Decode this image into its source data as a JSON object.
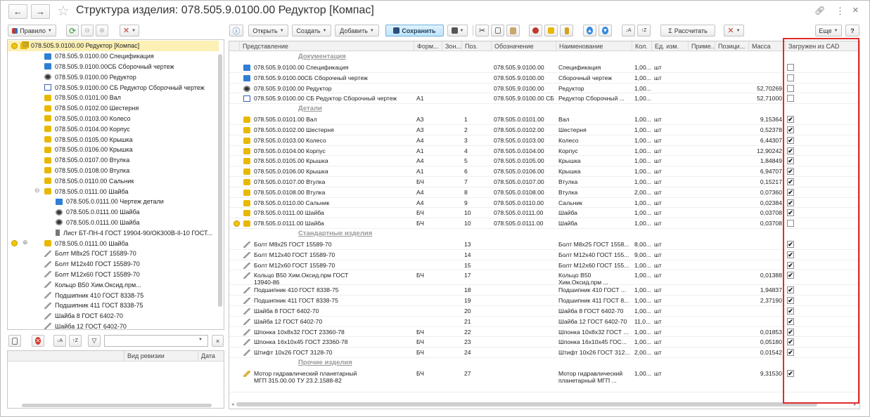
{
  "title": "Структура изделия: 078.505.9.0100.00 Редуктор [Компас]",
  "titlebar": {
    "back": "←",
    "forward": "→",
    "star": "☆",
    "link": "🔗",
    "more": "⋮",
    "close": "×"
  },
  "left_toolbar": {
    "rule_label": "Правило"
  },
  "main_toolbar": {
    "open": "Открыть",
    "create": "Создать",
    "add": "Добавить",
    "save": "Сохранить",
    "calculate": "Рассчитать",
    "more": "Еще",
    "help": "?"
  },
  "tree": [
    {
      "label": "078.505.9.0100.00 Редуктор [Компас]",
      "icon": "assembly-icon",
      "level": 0,
      "selected": true
    },
    {
      "label": "078.505.9.0100.00 Спецификация",
      "icon": "spec-icon",
      "level": 1
    },
    {
      "label": "078.505.9.0100.00СБ Сборочный чертеж",
      "icon": "spec-icon",
      "level": 1
    },
    {
      "label": "078.505.9.0100.00 Редуктор",
      "icon": "model-icon",
      "level": 1
    },
    {
      "label": "078.505.9.0100.00 СБ Редуктор Сборочный чертеж",
      "icon": "drawing-icon",
      "level": 1
    },
    {
      "label": "078.505.0.0101.00 Вал",
      "icon": "part-icon",
      "level": 1
    },
    {
      "label": "078.505.0.0102.00 Шестерня",
      "icon": "part-icon",
      "level": 1
    },
    {
      "label": "078.505.0.0103.00 Колесо",
      "icon": "part-icon",
      "level": 1
    },
    {
      "label": "078.505.0.0104.00 Корпус",
      "icon": "part-icon",
      "level": 1
    },
    {
      "label": "078.505.0.0105.00 Крышка",
      "icon": "part-icon",
      "level": 1
    },
    {
      "label": "078.505.0.0106.00 Крышка",
      "icon": "part-icon",
      "level": 1
    },
    {
      "label": "078.505.0.0107.00 Втулка",
      "icon": "part-icon",
      "level": 1
    },
    {
      "label": "078.505.0.0108.00 Втулка",
      "icon": "part-icon",
      "level": 1
    },
    {
      "label": "078.505.0.0110.00 Сальник",
      "icon": "part-icon",
      "level": 1
    },
    {
      "label": "078.505.0.0111.00 Шайба",
      "icon": "part-icon",
      "level": 1,
      "expanded": true
    },
    {
      "label": "078.505.0.0111.00 Чертеж детали",
      "icon": "spec-icon",
      "level": 2
    },
    {
      "label": "078.505.0.0111.00 Шайба",
      "icon": "model-icon",
      "level": 2
    },
    {
      "label": "078.505.0.0111.00 Шайба",
      "icon": "model-icon",
      "level": 2
    },
    {
      "label": "Лист БТ-ПН-4 ГОСТ 19904-90/ОК300В-II-10 ГОСТ...",
      "icon": "material-icon",
      "level": 2
    },
    {
      "label": "078.505.0.0111.00 Шайба",
      "icon": "part-icon",
      "level": 0,
      "collapsed": true
    },
    {
      "label": "Болт М8х25 ГОСТ 15589-70",
      "icon": "standard-icon",
      "level": 1
    },
    {
      "label": "Болт М12х40 ГОСТ 15589-70",
      "icon": "standard-icon",
      "level": 1
    },
    {
      "label": "Болт М12х60 ГОСТ 15589-70",
      "icon": "standard-icon",
      "level": 1
    },
    {
      "label": "Кольцо B50 Хим.Оксид.прм...",
      "icon": "standard-icon",
      "level": 1
    },
    {
      "label": "Подшипник 410 ГОСТ 8338-75",
      "icon": "standard-icon",
      "level": 1
    },
    {
      "label": "Подшипник 411 ГОСТ 8338-75",
      "icon": "standard-icon",
      "level": 1
    },
    {
      "label": "Шайба 8 ГОСТ 6402-70",
      "icon": "standard-icon",
      "level": 1
    },
    {
      "label": "Шайба 12 ГОСТ 6402-70",
      "icon": "standard-icon",
      "level": 1
    }
  ],
  "revisions": {
    "col_revision": "Вид ревизии",
    "col_date": "Дата"
  },
  "table": {
    "columns": [
      "Представление",
      "Форм...",
      "Зон...",
      "Поз.",
      "Обозначение",
      "Наименование",
      "Кол.",
      "Ед. изм.",
      "Приме...",
      "Позици...",
      "Масса",
      "Загружен из CAD"
    ],
    "rows": [
      {
        "group": "Документация"
      },
      {
        "rep": "078.505.9.0100.00 Спецификация",
        "icon": "spec-icon",
        "fmt": "",
        "pos": "",
        "des": "078.505.9.0100.00",
        "name": "Спецификация",
        "qty": "1,00...",
        "unit": "шт",
        "mass": "",
        "cad": false
      },
      {
        "rep": "078.505.9.0100.00СБ Сборочный чертеж",
        "icon": "spec-icon",
        "fmt": "",
        "pos": "",
        "des": "078.505.9.0100.00",
        "name": "Сборочный чертеж",
        "qty": "1,00...",
        "unit": "шт",
        "mass": "",
        "cad": false
      },
      {
        "rep": "078.505.9.0100.00 Редуктор",
        "icon": "model-icon",
        "fmt": "",
        "pos": "",
        "des": "078.505.9.0100.00",
        "name": "Редуктор",
        "qty": "1,00...",
        "unit": "",
        "mass": "52,70269",
        "cad": false
      },
      {
        "rep": "078.505.9.0100.00 СБ Редуктор Сборочный чертеж",
        "icon": "drawing-icon",
        "fmt": "А1",
        "pos": "",
        "des": "078.505.9.0100.00 СБ",
        "name": "Редуктор Сборочный ...",
        "qty": "1,00...",
        "unit": "",
        "mass": "52,71000",
        "cad": false
      },
      {
        "group": "Детали"
      },
      {
        "rep": "078.505.0.0101.00 Вал",
        "icon": "part-icon",
        "fmt": "А3",
        "pos": "1",
        "des": "078.505.0.0101.00",
        "name": "Вал",
        "qty": "1,00...",
        "unit": "шт",
        "mass": "9,15364",
        "cad": true
      },
      {
        "rep": "078.505.0.0102.00 Шестерня",
        "icon": "part-icon",
        "fmt": "А3",
        "pos": "2",
        "des": "078.505.0.0102.00",
        "name": "Шестерня",
        "qty": "1,00...",
        "unit": "шт",
        "mass": "0,52378",
        "cad": true
      },
      {
        "rep": "078.505.0.0103.00 Колесо",
        "icon": "part-icon",
        "fmt": "А4",
        "pos": "3",
        "des": "078.505.0.0103.00",
        "name": "Колесо",
        "qty": "1,00...",
        "unit": "шт",
        "mass": "6,44307",
        "cad": true
      },
      {
        "rep": "078.505.0.0104.00 Корпус",
        "icon": "part-icon",
        "fmt": "А1",
        "pos": "4",
        "des": "078.505.0.0104.00",
        "name": "Корпус",
        "qty": "1,00...",
        "unit": "шт",
        "mass": "12,90242",
        "cad": true
      },
      {
        "rep": "078.505.0.0105.00 Крышка",
        "icon": "part-icon",
        "fmt": "А4",
        "pos": "5",
        "des": "078.505.0.0105.00",
        "name": "Крышка",
        "qty": "1,00...",
        "unit": "шт",
        "mass": "1,84849",
        "cad": true
      },
      {
        "rep": "078.505.0.0106.00 Крышка",
        "icon": "part-icon",
        "fmt": "А1",
        "pos": "6",
        "des": "078.505.0.0106.00",
        "name": "Крышка",
        "qty": "1,00...",
        "unit": "шт",
        "mass": "6,94707",
        "cad": true
      },
      {
        "rep": "078.505.0.0107.00 Втулка",
        "icon": "part-icon",
        "fmt": "БЧ",
        "pos": "7",
        "des": "078.505.0.0107.00",
        "name": "Втулка",
        "qty": "1,00...",
        "unit": "шт",
        "mass": "0,15217",
        "cad": true
      },
      {
        "rep": "078.505.0.0108.00 Втулка",
        "icon": "part-icon",
        "fmt": "А4",
        "pos": "8",
        "des": "078.505.0.0108.00",
        "name": "Втулка",
        "qty": "2,00...",
        "unit": "шт",
        "mass": "0,07360",
        "cad": true
      },
      {
        "rep": "078.505.0.0110.00 Сальник",
        "icon": "part-icon",
        "fmt": "А4",
        "pos": "9",
        "des": "078.505.0.0110.00",
        "name": "Сальник",
        "qty": "1,00...",
        "unit": "шт",
        "mass": "0,02384",
        "cad": true
      },
      {
        "rep": "078.505.0.0111.00 Шайба",
        "icon": "part-icon",
        "fmt": "БЧ",
        "pos": "10",
        "des": "078.505.0.0111.00",
        "name": "Шайба",
        "qty": "1,00...",
        "unit": "шт",
        "mass": "0,03708",
        "cad": true
      },
      {
        "rep": "078.505.0.0111.00 Шайба",
        "icon": "part-icon",
        "bullet": true,
        "fmt": "БЧ",
        "pos": "10",
        "des": "078.505.0.0111.00",
        "name": "Шайба",
        "qty": "1,00...",
        "unit": "шт",
        "mass": "0,03708",
        "cad": false
      },
      {
        "group": "Стандартные изделия"
      },
      {
        "rep": "Болт М8х25 ГОСТ 15589-70",
        "icon": "standard-icon",
        "fmt": "",
        "pos": "13",
        "des": "",
        "name": "Болт М8х25 ГОСТ 1558...",
        "qty": "8,00...",
        "unit": "шт",
        "mass": "",
        "cad": true
      },
      {
        "rep": "Болт М12х40 ГОСТ 15589-70",
        "icon": "standard-icon",
        "fmt": "",
        "pos": "14",
        "des": "",
        "name": "Болт М12х40 ГОСТ 155...",
        "qty": "9,00...",
        "unit": "шт",
        "mass": "",
        "cad": true
      },
      {
        "rep": "Болт М12х60 ГОСТ 15589-70",
        "icon": "standard-icon",
        "fmt": "",
        "pos": "15",
        "des": "",
        "name": "Болт М12х60 ГОСТ 155...",
        "qty": "1,00...",
        "unit": "шт",
        "mass": "",
        "cad": true
      },
      {
        "rep": "Кольцо B50 Хим.Оксид.прм ГОСТ 13940-86",
        "icon": "standard-icon",
        "fmt": "БЧ",
        "pos": "17",
        "des": "",
        "name": "Кольцо B50 Хим.Оксид.прм ...",
        "qty": "1,00...",
        "unit": "шт",
        "mass": "0,01388",
        "cad": true,
        "tall": 2
      },
      {
        "rep": "Подшипник 410  ГОСТ 8338-75",
        "icon": "standard-icon",
        "fmt": "",
        "pos": "18",
        "des": "",
        "name": "Подшипник 410  ГОСТ ...",
        "qty": "1,00...",
        "unit": "шт",
        "mass": "1,94837",
        "cad": true
      },
      {
        "rep": "Подшипник 411 ГОСТ 8338-75",
        "icon": "standard-icon",
        "fmt": "",
        "pos": "19",
        "des": "",
        "name": "Подшипник 411 ГОСТ 8...",
        "qty": "1,00...",
        "unit": "шт",
        "mass": "2,37190",
        "cad": true
      },
      {
        "rep": "Шайба 8 ГОСТ 6402-70",
        "icon": "standard-icon",
        "fmt": "",
        "pos": "20",
        "des": "",
        "name": "Шайба 8 ГОСТ 6402-70",
        "qty": "1,00...",
        "unit": "шт",
        "mass": "",
        "cad": true
      },
      {
        "rep": "Шайба 12 ГОСТ 6402-70",
        "icon": "standard-icon",
        "fmt": "",
        "pos": "21",
        "des": "",
        "name": "Шайба 12 ГОСТ 6402-70",
        "qty": "11,0...",
        "unit": "шт",
        "mass": "",
        "cad": true
      },
      {
        "rep": "Шпонка 10х8х32 ГОСТ 23360-78",
        "icon": "standard-icon",
        "fmt": "БЧ",
        "pos": "22",
        "des": "",
        "name": "Шпонка 10х8х32 ГОСТ ...",
        "qty": "1,00...",
        "unit": "шт",
        "mass": "0,01853",
        "cad": true
      },
      {
        "rep": "Шпонка 16х10х45 ГОСТ 23360-78",
        "icon": "standard-icon",
        "fmt": "БЧ",
        "pos": "23",
        "des": "",
        "name": "Шпонка 16х10х45 ГОС...",
        "qty": "1,00...",
        "unit": "шт",
        "mass": "0,05180",
        "cad": true
      },
      {
        "rep": "Штифт 10х26 ГОСТ 3128-70",
        "icon": "standard-icon",
        "fmt": "БЧ",
        "pos": "24",
        "des": "",
        "name": "Штифт 10х26 ГОСТ 312...",
        "qty": "2,00...",
        "unit": "шт",
        "mass": "0,01542",
        "cad": true
      },
      {
        "group": "Прочие изделия"
      },
      {
        "rep": "Мотор гидравлический планетарный МГП 315.00.00 ТУ 23.2.1588-82",
        "icon": "motor-icon",
        "fmt": "БЧ",
        "pos": "27",
        "des": "",
        "name": "Мотор гидравлический планетарный МГП ...",
        "qty": "1,00...",
        "unit": "шт",
        "mass": "9,31530",
        "cad": true,
        "tall": 3
      }
    ]
  },
  "colors": {
    "selection": "#fcf0b4",
    "highlight_box": "#e02b2b",
    "save_button": "#bfe4fb"
  }
}
